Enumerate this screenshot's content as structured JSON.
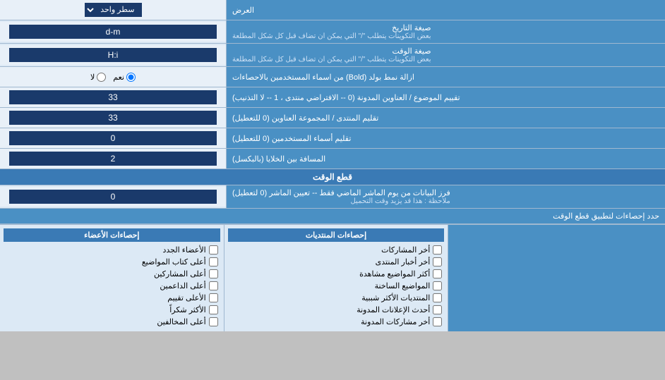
{
  "header": {
    "title": "العرض",
    "dropdown_label": "سطر واحد"
  },
  "rows": [
    {
      "id": "date-format",
      "label": "صيغة التاريخ\nبعض التكوينات يتطلب \"/\" التي يمكن ان تضاف قبل كل شكل المطلعة",
      "label_line1": "صيغة التاريخ",
      "label_line2": "بعض التكوينات يتطلب \"/\" التي يمكن ان تضاف قبل كل شكل المطلعة",
      "control_type": "text",
      "value": "d-m"
    },
    {
      "id": "time-format",
      "label_line1": "صيغة الوقت",
      "label_line2": "بعض التكوينات يتطلب \"/\" التي يمكن ان تضاف قبل كل شكل المطلعة",
      "control_type": "text",
      "value": "H:i"
    },
    {
      "id": "bold-remove",
      "label_line1": "ازالة نمط بولد (Bold) من اسماء المستخدمين بالاحصاءات",
      "label_line2": "",
      "control_type": "radio",
      "options": [
        {
          "value": "yes",
          "label": "نعم",
          "checked": true
        },
        {
          "value": "no",
          "label": "لا",
          "checked": false
        }
      ]
    },
    {
      "id": "forum-subject-order",
      "label_line1": "تقييم الموضوع / العناوين المدونة (0 -- الافتراضي منتدى ، 1 -- لا التذنيب)",
      "label_line2": "",
      "control_type": "number",
      "value": "33"
    },
    {
      "id": "forum-group-order",
      "label_line1": "تقليم المنتدى / المجموعة العناوين (0 للتعطيل)",
      "label_line2": "",
      "control_type": "number",
      "value": "33"
    },
    {
      "id": "users-names",
      "label_line1": "تقليم أسماء المستخدمين (0 للتعطيل)",
      "label_line2": "",
      "control_type": "number",
      "value": "0"
    },
    {
      "id": "cols-spacing",
      "label_line1": "المسافة بين الخلايا (بالبكسل)",
      "label_line2": "",
      "control_type": "number",
      "value": "2"
    }
  ],
  "cutoff_section": {
    "title": "قطع الوقت",
    "row": {
      "label_line1": "فرز البيانات من يوم الماشر الماضي فقط -- تعيين الماشر (0 لتعطيل)",
      "label_line2": "ملاحظة : هذا قد يزيد وقت التحميل",
      "control_type": "number",
      "value": "0"
    }
  },
  "stats_section": {
    "limit_label": "حدد إحصاءات لتطبيق قطع الوقت",
    "col1": {
      "header": "إحصاءات المنتديات",
      "items": [
        {
          "label": "أخر المشاركات",
          "checked": false
        },
        {
          "label": "أخر أخبار المنتدى",
          "checked": false
        },
        {
          "label": "أكثر المواضيع مشاهدة",
          "checked": false
        },
        {
          "label": "المواضيع الساخنة",
          "checked": false
        },
        {
          "label": "المنتديات الأكثر شببية",
          "checked": false
        },
        {
          "label": "أحدث الإعلانات المدونة",
          "checked": false
        },
        {
          "label": "أخر مشاركات المدونة",
          "checked": false
        }
      ]
    },
    "col2": {
      "header": "إحصاءات الأعضاء",
      "items": [
        {
          "label": "الأعضاء الجدد",
          "checked": false
        },
        {
          "label": "أعلى كتاب المواضيع",
          "checked": false
        },
        {
          "label": "أعلى المشاركين",
          "checked": false
        },
        {
          "label": "أعلى الداعمين",
          "checked": false
        },
        {
          "label": "الأعلى تقييم",
          "checked": false
        },
        {
          "label": "الأكثر شكراً",
          "checked": false
        },
        {
          "label": "أعلى المخالفين",
          "checked": false
        }
      ]
    },
    "col3": {
      "header": "",
      "items": []
    }
  }
}
